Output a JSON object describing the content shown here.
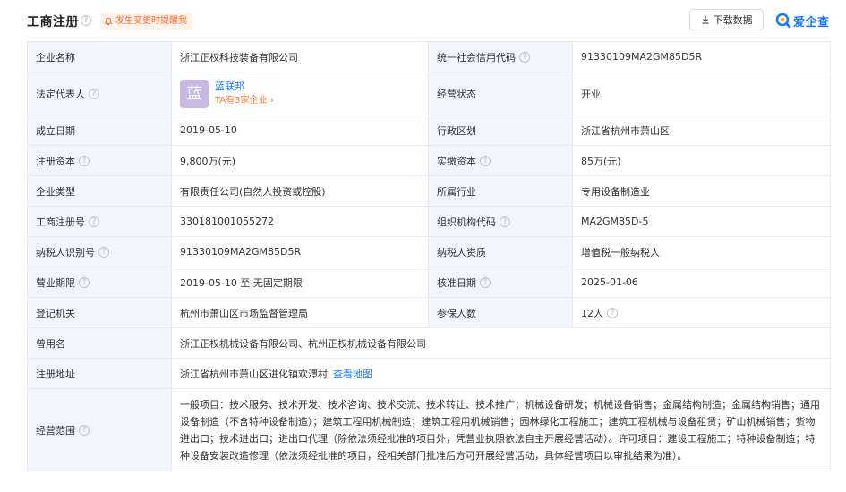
{
  "header": {
    "title": "工商注册",
    "alert_label": "发生变更时提醒我",
    "download_label": "下载数据",
    "logo_text": "爱企查"
  },
  "rows": [
    {
      "l1": "企业名称",
      "v1": "浙江正权科技装备有限公司",
      "l2": "统一社会信用代码",
      "v2": "91330109MA2GM85D5R"
    },
    {
      "l1": "法定代表人",
      "rep_avatar": "蓝",
      "rep_name": "蓝联邦",
      "rep_more": "TA有3家企业",
      "l2": "经营状态",
      "v2": "开业"
    },
    {
      "l1": "成立日期",
      "v1": "2019-05-10",
      "l2": "行政区划",
      "v2": "浙江省杭州市萧山区"
    },
    {
      "l1": "注册资本",
      "v1": "9,800万(元)",
      "l2": "实缴资本",
      "v2": "85万(元)"
    },
    {
      "l1": "企业类型",
      "v1": "有限责任公司(自然人投资或控股)",
      "l2": "所属行业",
      "v2": "专用设备制造业"
    },
    {
      "l1": "工商注册号",
      "v1": "330181001055272",
      "l2": "组织机构代码",
      "v2": "MA2GM85D-5"
    },
    {
      "l1": "纳税人识别号",
      "v1": "91330109MA2GM85D5R",
      "l2": "纳税人资质",
      "v2": "增值税一般纳税人"
    },
    {
      "l1": "营业期限",
      "v1": "2019-05-10 至 无固定期限",
      "l2": "核准日期",
      "v2": "2025-01-06"
    },
    {
      "l1": "登记机关",
      "v1": "杭州市萧山区市场监督管理局",
      "l2": "参保人数",
      "v2": "12人"
    },
    {
      "l1": "曾用名",
      "v1": "浙江正权机械设备有限公司、杭州正权机械设备有限公司"
    },
    {
      "l1": "注册地址",
      "v1": "浙江省杭州市萧山区进化镇欢潭村",
      "map_link": "查看地图"
    },
    {
      "l1": "经营范围",
      "v1": "一般项目：技术服务、技术开发、技术咨询、技术交流、技术转让、技术推广；机械设备研发；机械设备销售；金属结构制造；金属结构销售；通用设备制造（不含特种设备制造）；建筑工程用机械制造；建筑工程用机械销售；园林绿化工程施工；建筑工程机械与设备租赁；矿山机械销售；货物进出口；技术进出口；进出口代理（除依法须经批准的项目外，凭营业执照依法自主开展经营活动）。许可项目：建设工程施工；特种设备制造；特种设备安装改造修理（依法须经批准的项目，经相关部门批准后方可开展经营活动，具体经营项目以审批结果为准）。"
    }
  ],
  "colors": {
    "accent": "#1677ff",
    "alert": "#ff6a2b",
    "label_bg": "#f2f6fc",
    "border": "#e6ebf3"
  }
}
